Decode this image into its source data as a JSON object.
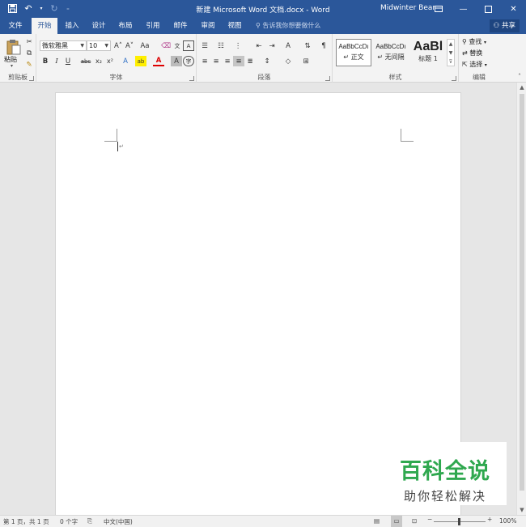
{
  "titlebar": {
    "title": "新建 Microsoft Word 文档.docx  -  Word",
    "user": "Midwinter Bear",
    "icons": [
      "save-icon",
      "undo-icon",
      "redo-icon",
      "customize-qat-icon",
      "ribbon-display-icon",
      "minimize-icon",
      "restore-icon",
      "close-icon"
    ]
  },
  "tabs": [
    {
      "label": "文件",
      "active": false
    },
    {
      "label": "开始",
      "active": true
    },
    {
      "label": "插入",
      "active": false
    },
    {
      "label": "设计",
      "active": false
    },
    {
      "label": "布局",
      "active": false
    },
    {
      "label": "引用",
      "active": false
    },
    {
      "label": "邮件",
      "active": false
    },
    {
      "label": "审阅",
      "active": false
    },
    {
      "label": "视图",
      "active": false
    }
  ],
  "tell_me": "告诉我你想要做什么",
  "share_label": "共享",
  "ribbon": {
    "clipboard": {
      "label": "剪贴板",
      "paste_label": "粘贴"
    },
    "font": {
      "label": "字体",
      "font_name": "微软雅黑",
      "font_size": "10",
      "bold": "B",
      "italic": "I",
      "underline": "U",
      "strike": "abc",
      "subscript": "x₂",
      "superscript": "x²",
      "grow": "A˄",
      "shrink": "A˅",
      "case": "Aa",
      "highlight": "ab",
      "color": "A",
      "char_border": "A"
    },
    "paragraph": {
      "label": "段落"
    },
    "styles": {
      "label": "样式",
      "items": [
        {
          "sample": "AaBbCcDı",
          "name": "↵ 正文"
        },
        {
          "sample": "AaBbCcDı",
          "name": "↵ 无间隔"
        },
        {
          "sample": "AaBl",
          "name": "标题 1"
        }
      ]
    },
    "editing": {
      "label": "编辑",
      "find": "查找",
      "replace": "替换",
      "select": "选择"
    }
  },
  "watermark": {
    "line1": "百科全说",
    "line2": "助你轻松解决"
  },
  "status": {
    "page": "第 1 页，共 1 页",
    "words": "0 个字",
    "language": "中文(中国)",
    "zoom": "100%",
    "zoom_level": 1.0
  },
  "colors": {
    "word_blue": "#2b579a",
    "ribbon_bg": "#f3f3f3",
    "watermark_green": "#2fa84f"
  }
}
